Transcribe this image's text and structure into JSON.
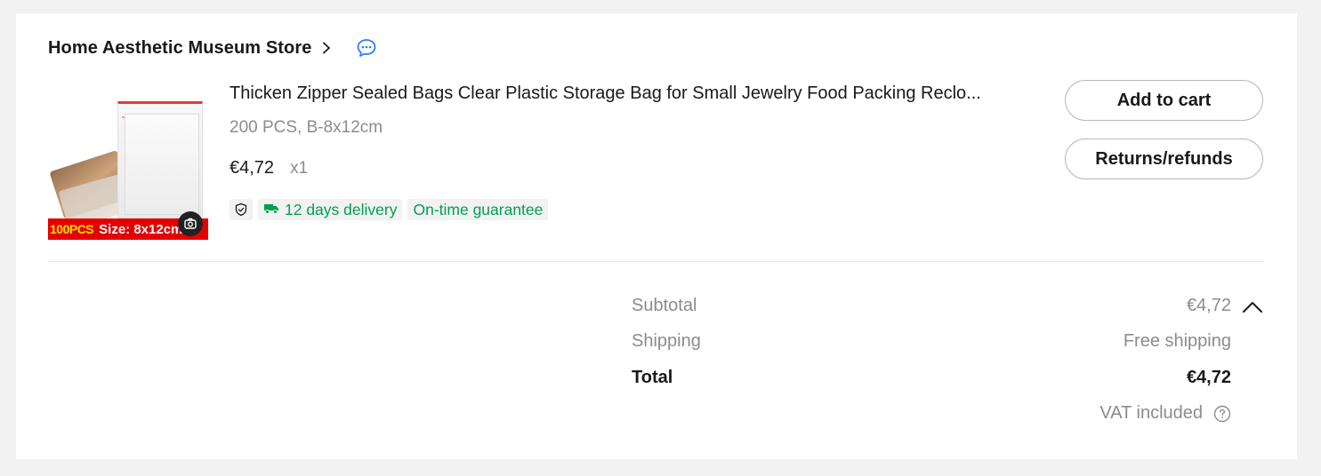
{
  "store": {
    "name": "Home Aesthetic Museum Store",
    "chevron_icon": "chevron-right-icon",
    "chat_icon": "chat-bubble-icon"
  },
  "product": {
    "image": {
      "banner_pcs": "100PCS",
      "banner_size": "Size: 8x12cm",
      "search_icon": "camera-icon"
    },
    "title": "Thicken Zipper Sealed Bags Clear Plastic Storage Bag for Small Jewelry Food Packing Reclo...",
    "variant": "200 PCS, B-8x12cm",
    "price": "€4,72",
    "quantity": "x1",
    "tags": {
      "shield_icon": "shield-check-icon",
      "delivery_icon": "truck-icon",
      "delivery": "12 days delivery",
      "guarantee": "On-time guarantee"
    }
  },
  "actions": {
    "add_to_cart": "Add to cart",
    "returns": "Returns/refunds"
  },
  "summary": {
    "subtotal_label": "Subtotal",
    "subtotal_value": "€4,72",
    "shipping_label": "Shipping",
    "shipping_value": "Free shipping",
    "total_label": "Total",
    "total_value": "€4,72",
    "vat_label": "VAT included",
    "collapse_icon": "chevron-up-icon",
    "help_icon": "question-circle-icon"
  },
  "colors": {
    "accent_green": "#00a050",
    "chat_blue": "#2d7ff9",
    "banner_red": "#e50000"
  }
}
